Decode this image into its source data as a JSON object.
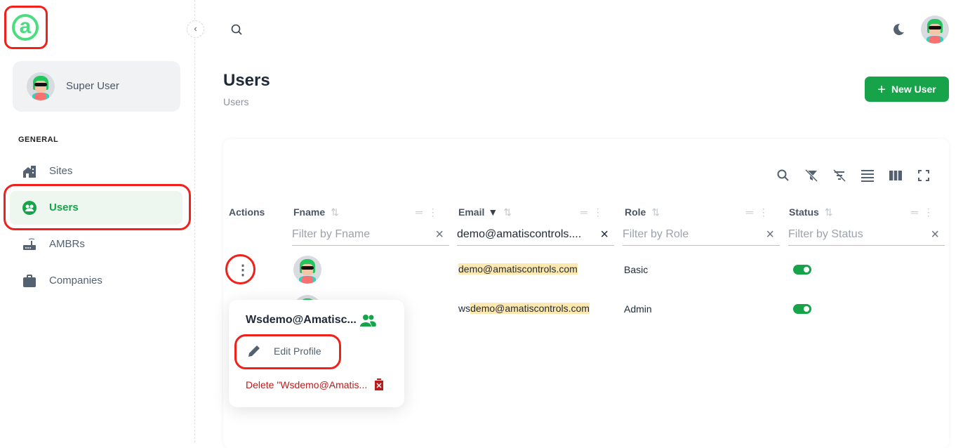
{
  "sidebar": {
    "user_name": "Super User",
    "section": "GENERAL",
    "items": [
      {
        "label": "Sites",
        "icon": "building-icon"
      },
      {
        "label": "Users",
        "icon": "users-icon",
        "active": true
      },
      {
        "label": "AMBRs",
        "icon": "router-icon"
      },
      {
        "label": "Companies",
        "icon": "briefcase-icon"
      }
    ]
  },
  "header": {
    "title": "Users",
    "breadcrumb": "Users",
    "new_button": "New User"
  },
  "table": {
    "columns": [
      {
        "label": "Actions"
      },
      {
        "label": "Fname",
        "filter_placeholder": "Filter by Fname"
      },
      {
        "label": "Email",
        "filter_value": "demo@amatiscontrols...."
      },
      {
        "label": "Role",
        "filter_placeholder": "Filter by Role"
      },
      {
        "label": "Status",
        "filter_placeholder": "Filter by Status"
      }
    ],
    "rows": [
      {
        "email_prefix": "",
        "email_match": "demo@amatiscontrols.com",
        "role": "Basic",
        "status": true
      },
      {
        "email_prefix": "ws",
        "email_match": "demo@amatiscontrols.com",
        "role": "Admin",
        "status": true
      }
    ]
  },
  "menu": {
    "title": "Wsdemo@Amatisc...",
    "edit": "Edit Profile",
    "delete": "Delete \"Wsdemo@Amatis..."
  },
  "colors": {
    "accent": "#16a34a",
    "danger": "#b91c1c",
    "highlight": "#fde8b0"
  }
}
